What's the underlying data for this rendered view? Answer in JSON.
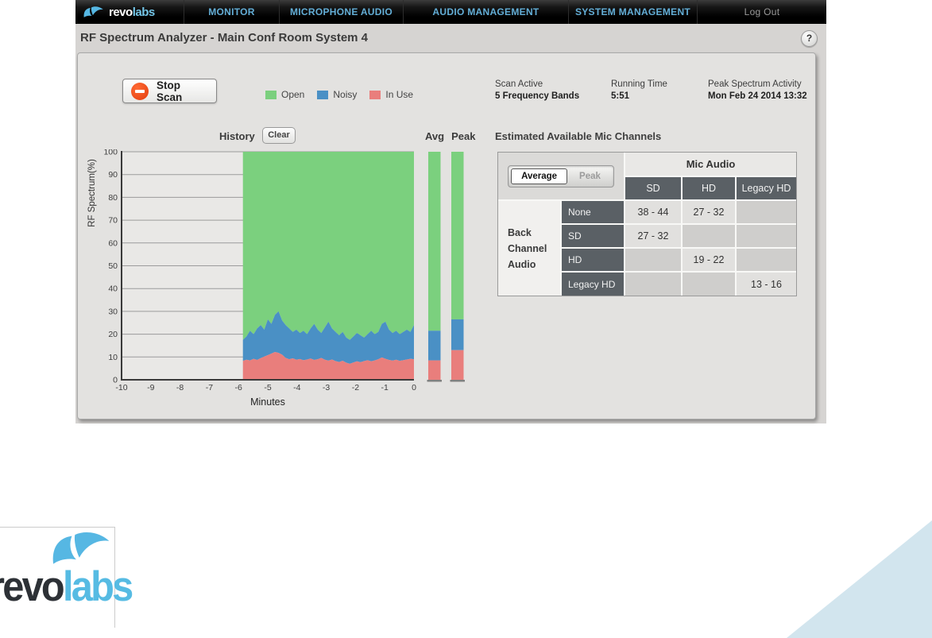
{
  "window": {
    "title": "RF Spectrum Analyzer - Main Conf Room System 4",
    "help_label": "?"
  },
  "nav": {
    "logo": {
      "revo": "revo",
      "labs": "labs"
    },
    "items": [
      {
        "label": "MONITOR"
      },
      {
        "label": "MICROPHONE AUDIO"
      },
      {
        "label": "AUDIO MANAGEMENT"
      },
      {
        "label": "SYSTEM MANAGEMENT"
      }
    ],
    "logout_label": "Log Out"
  },
  "toolbar": {
    "stop_scan_label": "Stop Scan"
  },
  "legend": [
    {
      "label": "Open",
      "color": "#7bd07e"
    },
    {
      "label": "Noisy",
      "color": "#4a90c5"
    },
    {
      "label": "In Use",
      "color": "#e97e7c"
    }
  ],
  "scan_info": [
    {
      "label": "Scan Active",
      "value": "5 Frequency Bands"
    },
    {
      "label": "Running Time",
      "value": "5:51"
    },
    {
      "label": "Peak Spectrum Activity",
      "value": "Mon Feb 24 2014 13:32"
    }
  ],
  "history_header": {
    "title": "History",
    "clear_label": "Clear",
    "avg_label": "Avg",
    "peak_label": "Peak"
  },
  "chart_data": {
    "type": "area",
    "title": "History",
    "xlabel": "Minutes",
    "ylabel": "RF Spectrum(%)",
    "xlim": [
      -10,
      0
    ],
    "ylim": [
      0,
      100
    ],
    "x_ticks": [
      -10,
      -9,
      -8,
      -7,
      -6,
      -5,
      -4,
      -3,
      -2,
      -1,
      0
    ],
    "y_ticks": [
      0,
      10,
      20,
      30,
      40,
      50,
      60,
      70,
      80,
      90,
      100
    ],
    "grid": true,
    "stack_order_bottom_to_top": [
      "In Use",
      "Noisy",
      "Open"
    ],
    "history": {
      "x_start": -5.85,
      "x_end": 0,
      "in_use_top": [
        8.3,
        8.8,
        8.5,
        9.2,
        8.7,
        9.5,
        10.2,
        10.8,
        11.5,
        12.2,
        11.8,
        11.0,
        9.6,
        9.0,
        9.4,
        8.8,
        9.1,
        8.6,
        8.9,
        9.3,
        8.7,
        9.0,
        9.6,
        8.8,
        8.4,
        8.9,
        8.2,
        7.8,
        8.3,
        7.5,
        7.0,
        7.6,
        8.1,
        7.7,
        8.2,
        8.6,
        8.1,
        8.5,
        9.0,
        9.8,
        9.2,
        8.7,
        8.4,
        8.8,
        8.3,
        8.6,
        8.9,
        9.2,
        9.0
      ],
      "noisy_top": [
        17.5,
        19.0,
        21.5,
        20.0,
        22.5,
        24.0,
        22.0,
        26.5,
        24.5,
        28.5,
        30.0,
        26.0,
        24.0,
        22.5,
        21.0,
        22.0,
        20.5,
        21.5,
        20.0,
        22.5,
        24.5,
        22.0,
        20.5,
        23.0,
        25.5,
        22.5,
        21.0,
        19.5,
        21.0,
        18.5,
        17.5,
        19.0,
        20.5,
        19.5,
        18.5,
        20.0,
        21.5,
        20.0,
        21.0,
        24.5,
        25.5,
        22.0,
        20.5,
        21.5,
        20.0,
        21.0,
        22.0,
        21.0,
        24.0
      ],
      "open_top": 100
    },
    "bars": [
      {
        "name": "Avg",
        "in_use_top": 8.5,
        "noisy_top": 21.5,
        "open_top": 100
      },
      {
        "name": "Peak",
        "in_use_top": 13.0,
        "noisy_top": 26.5,
        "open_top": 100
      }
    ]
  },
  "mic_table": {
    "title": "Estimated Available Mic Channels",
    "toggle": {
      "average_label": "Average",
      "peak_label": "Peak",
      "active": "Average"
    },
    "col_group": "Mic Audio",
    "columns": [
      "SD",
      "HD",
      "Legacy HD"
    ],
    "row_group": "Back Channel Audio",
    "rows": [
      {
        "label": "None",
        "values": [
          "38 - 44",
          "27 - 32",
          ""
        ]
      },
      {
        "label": "SD",
        "values": [
          "27 - 32",
          "",
          ""
        ]
      },
      {
        "label": "HD",
        "values": [
          "",
          "19 - 22",
          ""
        ]
      },
      {
        "label": "Legacy HD",
        "values": [
          "",
          "",
          "13 - 16"
        ]
      }
    ]
  },
  "footer_logo": {
    "revo": "revo",
    "labs": "labs"
  },
  "colors": {
    "open": "#7bd07e",
    "noisy": "#4a90c5",
    "in_use": "#e97e7c",
    "nav_link": "#63aed7",
    "stop_icon_red": "#e8481d",
    "table_header_dark": "#5a6065",
    "corner_triangle": "#d2e5ee",
    "logo_blue": "#56bbe3"
  }
}
